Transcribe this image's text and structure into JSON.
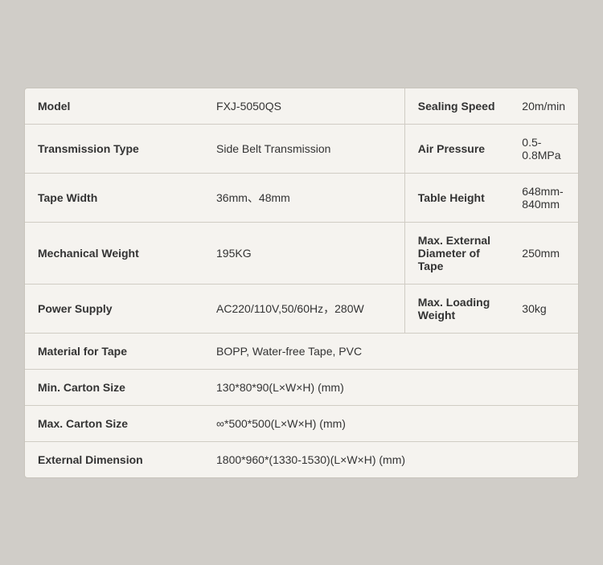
{
  "rows": [
    {
      "type": "half",
      "left": {
        "label": "Model",
        "value": "FXJ-5050QS"
      },
      "right": {
        "label": "Sealing Speed",
        "value": "20m/min"
      }
    },
    {
      "type": "half",
      "left": {
        "label": "Transmission Type",
        "value": "Side Belt Transmission"
      },
      "right": {
        "label": "Air Pressure",
        "value": "0.5-0.8MPa"
      }
    },
    {
      "type": "half",
      "left": {
        "label": "Tape Width",
        "value": "36mm、48mm"
      },
      "right": {
        "label": "Table Height",
        "value": "648mm-840mm"
      }
    },
    {
      "type": "half",
      "left": {
        "label": "Mechanical Weight",
        "value": "195KG"
      },
      "right": {
        "label": "Max. External Diameter of Tape",
        "value": "250mm"
      }
    },
    {
      "type": "half",
      "left": {
        "label": "Power Supply",
        "value": "AC220/110V,50/60Hz，280W"
      },
      "right": {
        "label": "Max. Loading Weight",
        "value": "30kg"
      }
    },
    {
      "type": "full",
      "label": "Material for Tape",
      "value": "BOPP, Water-free Tape, PVC"
    },
    {
      "type": "full",
      "label": "Min. Carton Size",
      "value": "130*80*90(L×W×H) (mm)"
    },
    {
      "type": "full",
      "label": "Max. Carton Size",
      "value": "∞*500*500(L×W×H) (mm)"
    },
    {
      "type": "full",
      "label": "External Dimension",
      "value": "1800*960*(1330-1530)(L×W×H) (mm)"
    }
  ]
}
